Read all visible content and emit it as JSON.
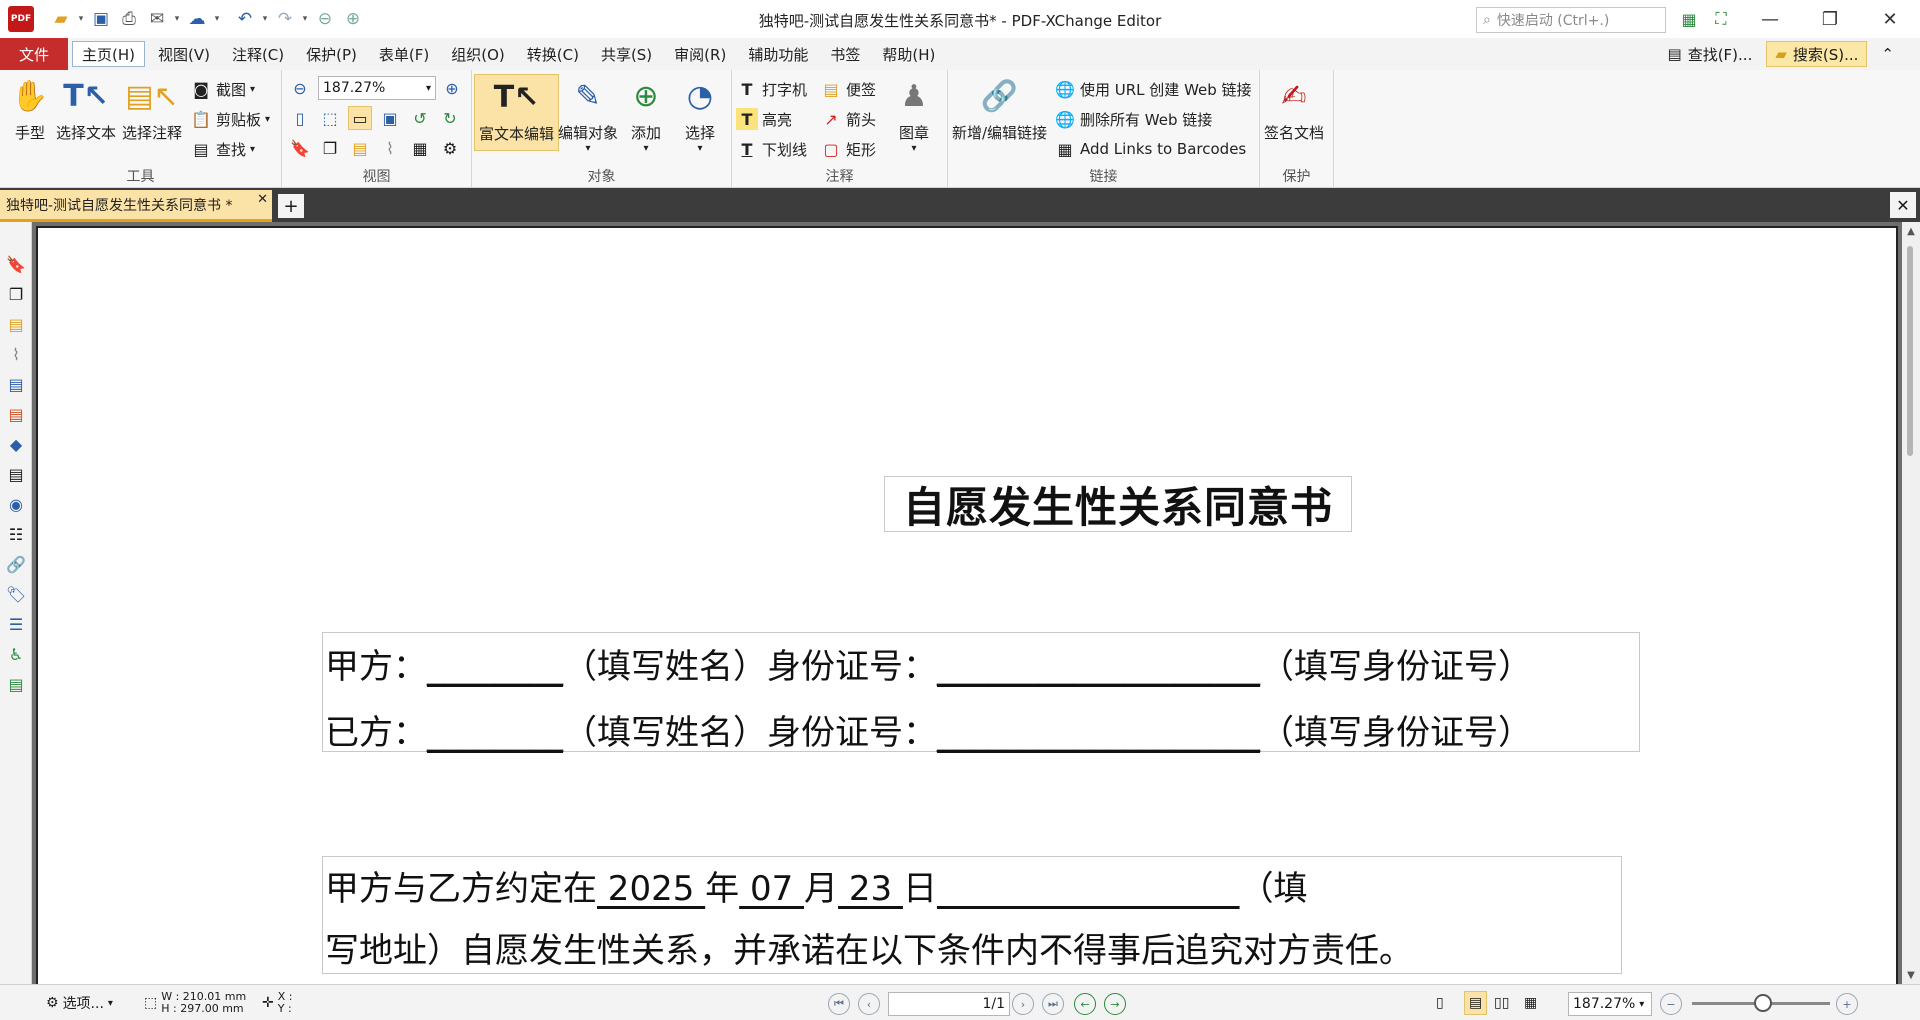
{
  "window": {
    "title": "独特吧-测试自愿发生性关系同意书* - PDF-XChange Editor",
    "quick_launch_placeholder": "快速启动 (Ctrl+.)",
    "logo_text": "PDF"
  },
  "menu": {
    "file": "文件",
    "items": [
      "主页(H)",
      "视图(V)",
      "注释(C)",
      "保护(P)",
      "表单(F)",
      "组织(O)",
      "转换(C)",
      "共享(S)",
      "审阅(R)",
      "辅助功能",
      "书签",
      "帮助(H)"
    ],
    "find": "查找(F)...",
    "search": "搜索(S)..."
  },
  "ribbon": {
    "tools": {
      "label": "工具",
      "hand": "手型",
      "select_text": "选择文本",
      "select_comment": "选择注释",
      "snapshot": "截图",
      "clipboard": "剪贴板",
      "find": "查找"
    },
    "view": {
      "label": "视图",
      "zoom": "187.27%"
    },
    "objects": {
      "label": "对象",
      "rich_text": "富文本编辑",
      "edit_object": "编辑对象",
      "add": "添加",
      "select": "选择"
    },
    "comments": {
      "label": "注释",
      "typewriter": "打字机",
      "note": "便签",
      "highlight": "高亮",
      "arrow": "箭头",
      "underline": "下划线",
      "rectangle": "矩形",
      "stamp": "图章"
    },
    "links": {
      "label": "链接",
      "add_edit": "新增/编辑链接",
      "create_web": "使用 URL 创建 Web 链接",
      "delete_web": "删除所有 Web 链接",
      "barcodes": "Add Links to Barcodes"
    },
    "protect": {
      "label": "保护",
      "sign": "签名文档"
    }
  },
  "doc_tab": {
    "name": "独特吧-测试自愿发生性关系同意书 *"
  },
  "document": {
    "title": "自愿发生性关系同意书",
    "party_a": {
      "prefix": "甲方：",
      "blank1": "________",
      "mid": "（填写姓名）身份证号：",
      "blank2": "___________________",
      "suffix": "（填写身份证号）"
    },
    "party_b": {
      "prefix": "已方：",
      "blank1": "________",
      "mid": "（填写姓名）身份证号：",
      "blank2": "___________________",
      "suffix": "（填写身份证号）"
    },
    "agreement": {
      "lead": "甲方与乙方约定在",
      "year": " 2025 ",
      "year_unit": "年",
      "month": " 07 ",
      "month_unit": "月",
      "day": " 23 ",
      "day_unit": "日",
      "address_blank": "                            ",
      "tail1": "（填",
      "line2": "写地址）自愿发生性关系，并承诺在以下条件内不得事后追究对方责任。"
    }
  },
  "status": {
    "options": "选项...",
    "width": "W : 210.01 mm",
    "height": "H : 297.00 mm",
    "x": "X :",
    "y": "Y :",
    "page": "1/1",
    "zoom": "187.27%"
  }
}
